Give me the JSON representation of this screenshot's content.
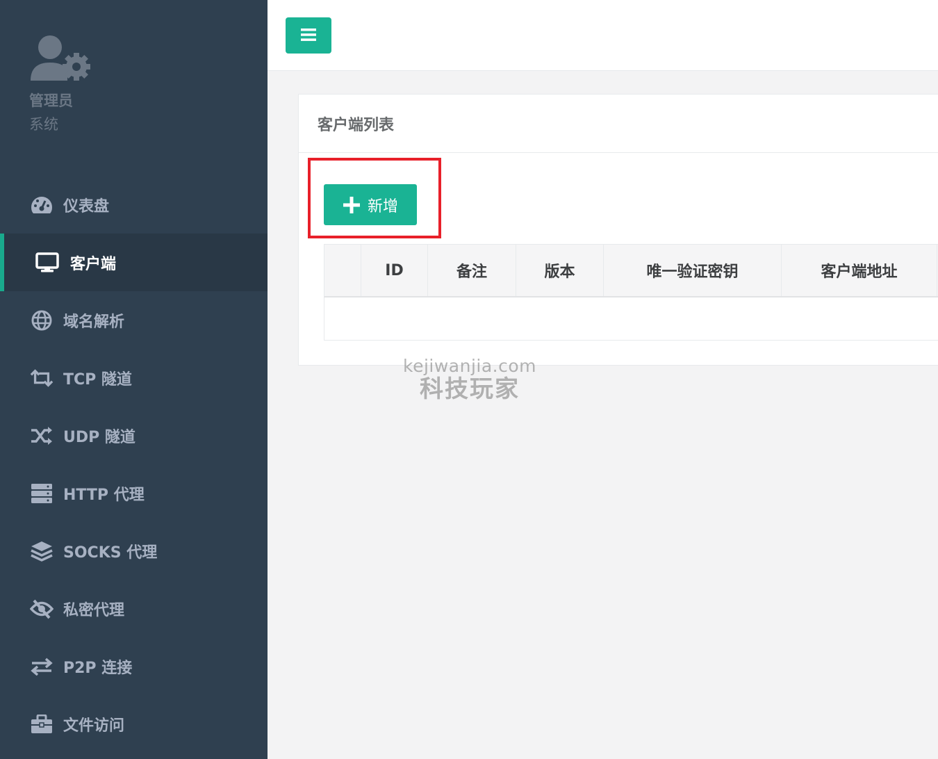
{
  "profile": {
    "name": "管理员",
    "role": "系统",
    "icon": "user-gear-icon"
  },
  "nav": {
    "items": [
      {
        "label": "仪表盘",
        "icon": "dashboard-icon"
      },
      {
        "label": "客户端",
        "icon": "monitor-icon",
        "active": true
      },
      {
        "label": "域名解析",
        "icon": "globe-icon"
      },
      {
        "label": "TCP 隧道",
        "icon": "retweet-icon"
      },
      {
        "label": "UDP 隧道",
        "icon": "shuffle-icon"
      },
      {
        "label": "HTTP 代理",
        "icon": "server-icon"
      },
      {
        "label": "SOCKS 代理",
        "icon": "layers-icon"
      },
      {
        "label": "私密代理",
        "icon": "eye-slash-icon"
      },
      {
        "label": "P2P 连接",
        "icon": "exchange-icon"
      },
      {
        "label": "文件访问",
        "icon": "briefcase-icon"
      }
    ]
  },
  "topbar": {
    "menu_icon": "hamburger-icon"
  },
  "panel": {
    "title": "客户端列表",
    "add_label": "新增",
    "columns": [
      "",
      "ID",
      "备注",
      "版本",
      "唯一验证密钥",
      "客户端地址"
    ]
  },
  "watermark": {
    "line1": "kejiwanjia.com",
    "line2": "科技玩家"
  },
  "colors": {
    "sidebar": "#2f4050",
    "active_bg": "#293846",
    "accent": "#1ab394",
    "highlight": "#e8202a"
  }
}
